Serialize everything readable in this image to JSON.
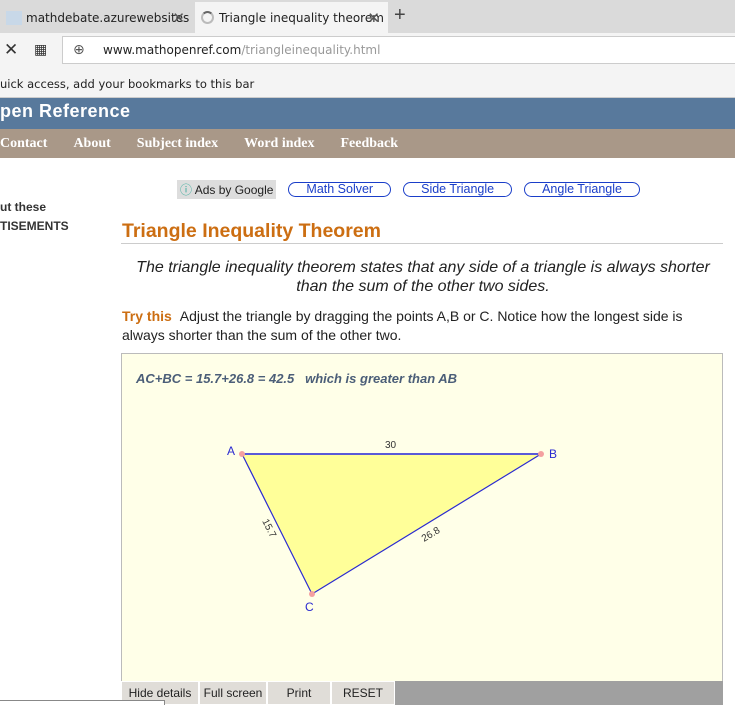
{
  "browser": {
    "tabs": [
      {
        "title": "mathdebate.azurewebsites",
        "active": false
      },
      {
        "title": "Triangle inequality theorem",
        "active": true
      }
    ],
    "url_domain": "www.mathopenref.com",
    "url_path": "/triangleinequality.html",
    "bookmarks_hint": "uick access, add your bookmarks to this bar"
  },
  "site": {
    "banner": "pen Reference",
    "nav": [
      "Contact",
      "About",
      "Subject index",
      "Word index",
      "Feedback"
    ]
  },
  "ads": {
    "label": "Ads by Google",
    "links": [
      "Math Solver",
      "Side Triangle",
      "Angle Triangle"
    ]
  },
  "sidebar": {
    "line1": "ut these",
    "line2": "TISEMENTS"
  },
  "main": {
    "title": "Triangle Inequality Theorem",
    "lead": "The triangle inequality theorem states that any side of a triangle is always shorter than the sum of the other two sides.",
    "try_label": "Try this",
    "try_text": "Adjust the triangle by dragging the points A,B or C. Notice how the longest side is always shorter than the sum of the other two."
  },
  "applet": {
    "equation": "AC+BC = 15.7+26.8 = 42.5   which is greater than AB",
    "points": {
      "A": "A",
      "B": "B",
      "C": "C"
    },
    "sides": {
      "AB": "30",
      "AC": "15.7",
      "BC": "26.8"
    },
    "fill_color": "#ffff99",
    "edge_color": "#2a2ad0",
    "buttons": [
      "Hide details",
      "Full screen",
      "Print",
      "RESET"
    ]
  }
}
